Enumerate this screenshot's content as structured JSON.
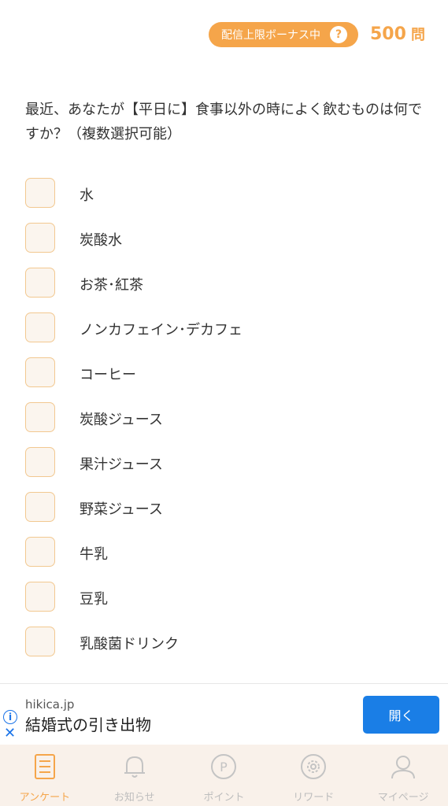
{
  "header": {
    "bonus_label": "配信上限ボーナス中",
    "help_label": "?",
    "question_count": "500",
    "question_unit": "問"
  },
  "question": {
    "text": "最近、あなたが【平日に】食事以外の時によく飲むものは何ですか？（複数選択可能）"
  },
  "options": [
    {
      "label": "水",
      "checked": false
    },
    {
      "label": "炭酸水",
      "checked": false
    },
    {
      "label": "お茶･紅茶",
      "checked": false
    },
    {
      "label": "ノンカフェイン･デカフェ",
      "checked": false
    },
    {
      "label": "コーヒー",
      "checked": false
    },
    {
      "label": "炭酸ジュース",
      "checked": false
    },
    {
      "label": "果汁ジュース",
      "checked": false
    },
    {
      "label": "野菜ジュース",
      "checked": false
    },
    {
      "label": "牛乳",
      "checked": false
    },
    {
      "label": "豆乳",
      "checked": false
    },
    {
      "label": "乳酸菌ドリンク",
      "checked": false
    }
  ],
  "ad": {
    "domain": "hikica.jp",
    "title": "結婚式の引き出物",
    "open_label": "開く",
    "info_icon": "info-icon",
    "close_icon": "close-icon"
  },
  "nav": {
    "items": [
      {
        "label": "アンケート",
        "icon": "survey-icon",
        "active": true
      },
      {
        "label": "お知らせ",
        "icon": "bell-icon",
        "active": false
      },
      {
        "label": "ポイント",
        "icon": "point-icon",
        "active": false
      },
      {
        "label": "リワード",
        "icon": "gear-icon",
        "active": false
      },
      {
        "label": "マイページ",
        "icon": "user-icon",
        "active": false
      }
    ]
  },
  "colors": {
    "accent": "#f5a54a",
    "checkbox_border": "#f2c890",
    "checkbox_fill": "#fbf5ee",
    "nav_bg": "#f9f1ea",
    "ad_button": "#1a7ee6"
  }
}
